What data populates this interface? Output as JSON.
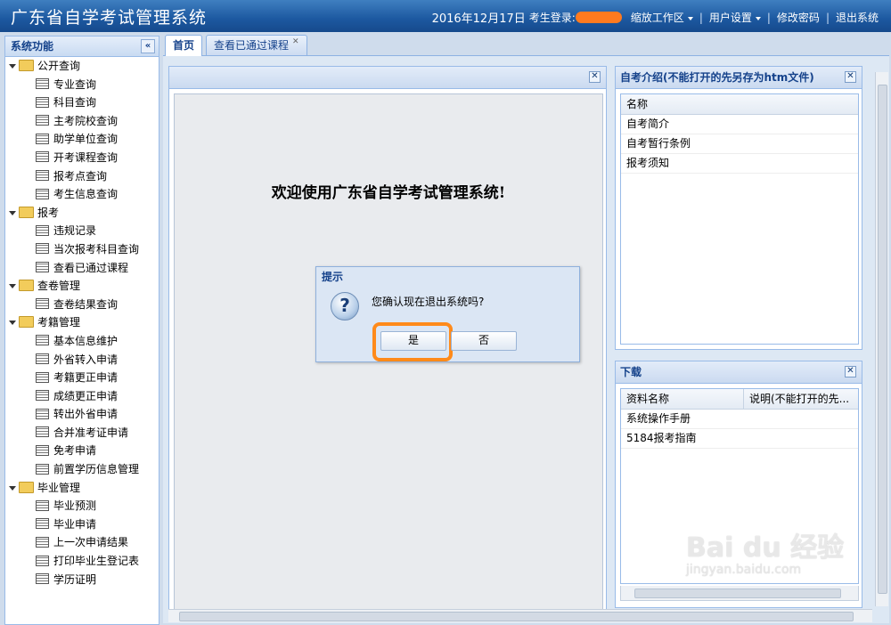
{
  "header": {
    "title": "广东省自学考试管理系统",
    "date": "2016年12月17日",
    "login_label": "考生登录:",
    "links": [
      "缩放工作区",
      "用户设置",
      "修改密码",
      "退出系统"
    ]
  },
  "sidebar": {
    "title": "系统功能",
    "collapse_label": "«",
    "groups": [
      {
        "label": "公开查询",
        "items": [
          "专业查询",
          "科目查询",
          "主考院校查询",
          "助学单位查询",
          "开考课程查询",
          "报考点查询",
          "考生信息查询"
        ]
      },
      {
        "label": "报考",
        "items": [
          "违规记录",
          "当次报考科目查询",
          "查看已通过课程"
        ]
      },
      {
        "label": "查卷管理",
        "items": [
          "查卷结果查询"
        ]
      },
      {
        "label": "考籍管理",
        "items": [
          "基本信息维护",
          "外省转入申请",
          "考籍更正申请",
          "成绩更正申请",
          "转出外省申请",
          "合并准考证申请",
          "免考申请",
          "前置学历信息管理"
        ]
      },
      {
        "label": "毕业管理",
        "items": [
          "毕业预测",
          "毕业申请",
          "上一次申请结果",
          "打印毕业生登记表",
          "学历证明"
        ]
      }
    ]
  },
  "tabs": [
    {
      "label": "首页",
      "active": true
    },
    {
      "label": "查看已通过课程",
      "active": false
    }
  ],
  "welcome": {
    "text": "欢迎使用广东省自学考试管理系统!"
  },
  "intro_panel": {
    "title": "自考介绍(不能打开的先另存为htm文件)",
    "column": "名称",
    "rows": [
      "自考简介",
      "自考暂行条例",
      "报考须知"
    ]
  },
  "download_panel": {
    "title": "下载",
    "columns": [
      "资料名称",
      "说明(不能打开的先..."
    ],
    "rows": [
      "系统操作手册",
      "5184报考指南"
    ]
  },
  "dialog": {
    "title": "提示",
    "icon": "question-icon",
    "message": "您确认现在退出系统吗?",
    "yes_label": "是",
    "no_label": "否",
    "highlight_color": "#ff8a1a"
  },
  "watermark": {
    "main": "Bai du 经验",
    "sub": "jingyan.baidu.com"
  }
}
